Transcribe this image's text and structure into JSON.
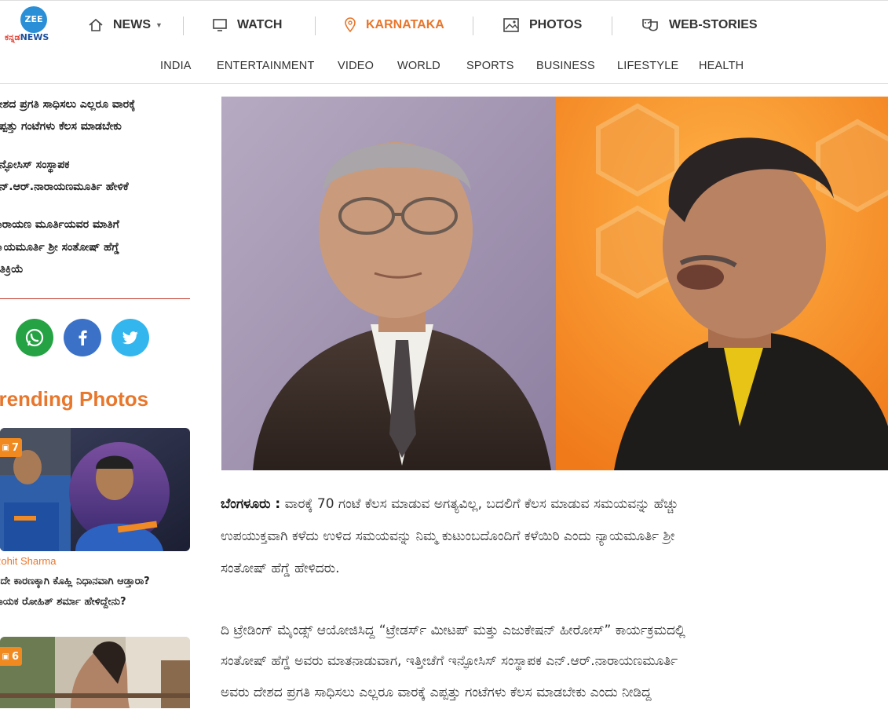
{
  "logo": {
    "circle_text": "ZEE",
    "brand_kannada": "ಕನ್ನಡ",
    "brand_news": "NEWS"
  },
  "nav": {
    "news": "NEWS",
    "watch": "WATCH",
    "karnataka": "KARNATAKA",
    "photos": "PHOTOS",
    "web_stories": "WEB-STORIES"
  },
  "subnav": [
    "INDIA",
    "ENTERTAINMENT",
    "VIDEO",
    "WORLD",
    "SPORTS",
    "BUSINESS",
    "LIFESTYLE",
    "HEALTH"
  ],
  "sidebar": {
    "lines": [
      "ದೇಶದ ಪ್ರಗತಿ ಸಾಧಿಸಲು ಎಲ್ಲರೂ ವಾರಕ್ಕೆ",
      "ಎಪ್ಪತ್ತು ಗಂಟೆಗಳು ಕೆಲಸ ಮಾಡಬೇಕು",
      "ಇನ್ಫೋಸಿಸ್ ಸಂಸ್ಥಾಪಕ",
      "ಎನ್.ಆರ್.ನಾರಾಯಣಮೂರ್ತಿ ಹೇಳಿಕೆ",
      "ನಾರಾಯಣ ಮೂರ್ತಿಯವರ ಮಾತಿಗೆ",
      "ನ್ಯಾಯಮೂರ್ತಿ ಶ್ರೀ ಸಂತೋಷ್ ಹೆಗ್ಡೆ",
      "ಪ್ರತಿಕ್ರಿಯೆ"
    ],
    "trending_title": "Trending Photos",
    "cards": [
      {
        "count": "7",
        "tag": "Rohit Sharma",
        "caption_lines": [
          "ಇದೇ ಕಾರಣಕ್ಕಾಗಿ ಕೊಹ್ಲಿ ನಿಧಾನವಾಗಿ ಆಡ್ತಾರಾ?",
          "ನಾಯಕ ರೋಹಿತ್ ಶರ್ಮಾ ಹೇಳಿದ್ದೇನು?"
        ]
      },
      {
        "count": "6"
      }
    ]
  },
  "article": {
    "dateline": "ಬೆಂಗಳೂರು :",
    "para1_lines": [
      "ವಾರಕ್ಕೆ 70 ಗಂಟೆ ಕೆಲಸ ಮಾಡುವ ಅಗತ್ಯವಿಲ್ಲ, ಬದಲಿಗೆ ಕೆಲಸ ಮಾಡುವ ಸಮಯವನ್ನು ಹೆಚ್ಚು",
      "ಉಪಯುಕ್ತವಾಗಿ ಕಳೆದು ಉಳಿದ ಸಮಯವನ್ನು ನಿಮ್ಮ ಕುಟುಂಬದೊಂದಿಗೆ ಕಳೆಯಿರಿ ಎಂದು ನ್ಯಾಯಮೂರ್ತಿ ಶ್ರೀ",
      "ಸಂತೋಷ್ ಹೆಗ್ಡೆ ಹೇಳಿದರು."
    ],
    "para2_lines": [
      "ದಿ ಟ್ರೇಡಿಂಗ್ ಮೈಂಡ್ಸ್ ಆಯೋಜಿಸಿದ್ದ “ಟ್ರೇಡರ್ಸ್ ಮೀಟಪ್ ಮತ್ತು ಎಜುಕೇಷನ್ ಹೀರೋಸ್” ಕಾರ್ಯಕ್ರಮದಲ್ಲಿ",
      "ಸಂತೋಷ್ ಹೆಗ್ಡೆ ಅವರು ಮಾತನಾಡುವಾಗ, ಇತ್ತೀಚೆಗೆ ಇನ್ಫೋಸಿಸ್ ಸಂಸ್ಥಾಪಕ ಎನ್.ಆರ್.ನಾರಾಯಣಮೂರ್ತಿ",
      "ಅವರು ದೇಶದ ಪ್ರಗತಿ ಸಾಧಿಸಲು ಎಲ್ಲರೂ ವಾರಕ್ಕೆ ಎಪ್ಪತ್ತು ಗಂಟೆಗಳು ಕೆಲಸ ಮಾಡಬೇಕು ಎಂದು ನೀಡಿದ್ದ"
    ]
  },
  "colors": {
    "accent": "#e8762b",
    "brand_blue": "#2a8fd6",
    "divider_red": "#c0392b"
  }
}
